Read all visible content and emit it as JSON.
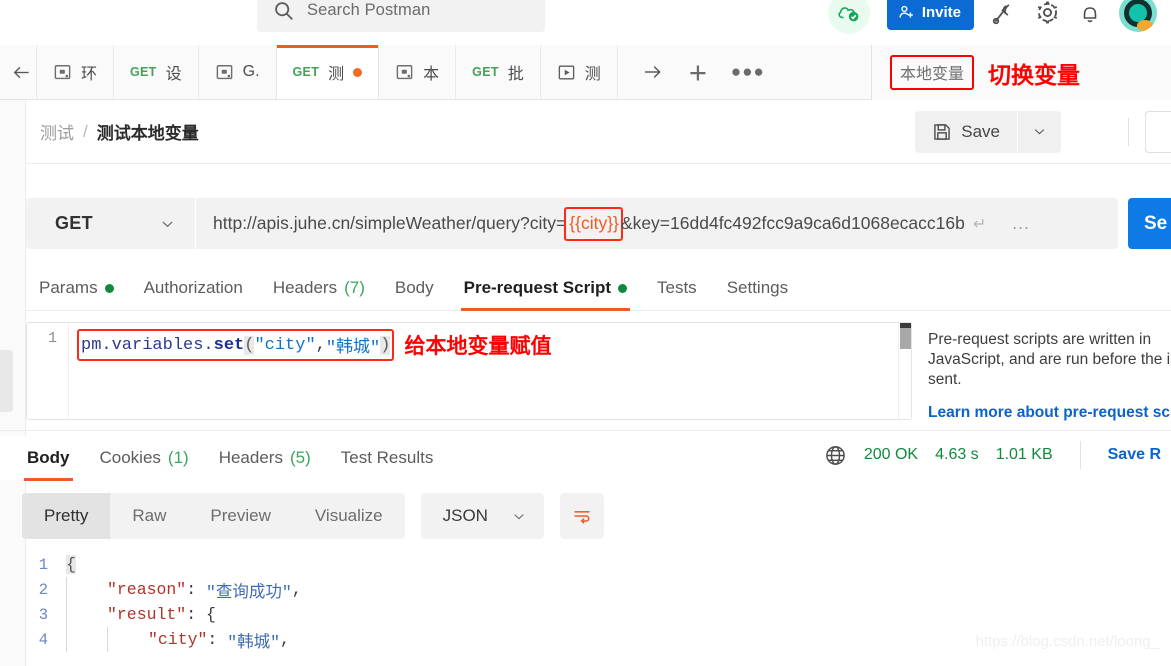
{
  "topbar": {
    "search_placeholder": "Search Postman",
    "invite_label": "Invite",
    "icons": [
      "cloud-sync-icon",
      "satellite-icon",
      "gear-icon",
      "bell-icon",
      "avatar"
    ]
  },
  "tabstrip": {
    "back_icon": "back-arrow-icon",
    "tabs": [
      {
        "icon": "collection-icon",
        "method": "",
        "name": "环"
      },
      {
        "icon": "",
        "method": "GET",
        "name": "设"
      },
      {
        "icon": "collection-icon",
        "method": "",
        "name": "G."
      },
      {
        "icon": "",
        "method": "GET",
        "name": "测",
        "unsaved": true,
        "active": true
      },
      {
        "icon": "collection-icon",
        "method": "",
        "name": "本"
      },
      {
        "icon": "",
        "method": "GET",
        "name": "批"
      },
      {
        "icon": "runner-icon",
        "method": "",
        "name": "测"
      }
    ],
    "forward_icon": "forward-arrow-icon",
    "new_tab_icon": "plus-icon",
    "more_icon": "ellipsis-icon",
    "environment": "本地变量",
    "annotation": "切换变量"
  },
  "breadcrumb": {
    "collection": "测试",
    "separator": "/",
    "request": "测试本地变量",
    "save_label": "Save",
    "save_icon": "floppy-disk-icon",
    "caret_icon": "chevron-down-icon",
    "more_icon": "ellipsis-icon"
  },
  "request": {
    "method": "GET",
    "url_prefix": "http://apis.juhe.cn/simpleWeather/query?city=",
    "url_variable": "{{city}}",
    "url_suffix": "&key=16dd4fc492fcc9a9ca6d1068ecacc16b",
    "url_full": "http://apis.juhe.cn/simpleWeather/query?city={{city}}&key=16dd4fc492fcc9a9ca6d1068ecacc16b",
    "enter_glyph": "↵",
    "overflow_dots": "...",
    "send_label": "Se",
    "tabs": [
      {
        "label": "Params",
        "dot": true
      },
      {
        "label": "Authorization"
      },
      {
        "label": "Headers",
        "count": "(7)"
      },
      {
        "label": "Body"
      },
      {
        "label": "Pre-request Script",
        "dot": true,
        "active": true
      },
      {
        "label": "Tests"
      },
      {
        "label": "Settings"
      }
    ]
  },
  "editor": {
    "line_number": "1",
    "code": {
      "obj": "pm.variables.",
      "fn": "set",
      "open": "(",
      "arg1": "\"city\"",
      "comma": ",",
      "arg2": "\"韩城\"",
      "close": ")"
    },
    "annotation": "给本地变量赋值"
  },
  "help": {
    "text": "Pre-request scripts are written in JavaScript, and are run before the is sent.",
    "link": "Learn more about pre-request scr"
  },
  "response": {
    "tabs": [
      {
        "label": "Body",
        "active": true
      },
      {
        "label": "Cookies",
        "count": "(1)"
      },
      {
        "label": "Headers",
        "count": "(5)"
      },
      {
        "label": "Test Results"
      }
    ],
    "globe_icon": "globe-icon",
    "status": "200 OK",
    "time": "4.63 s",
    "size": "1.01 KB",
    "save_response": "Save R",
    "view_modes": [
      "Pretty",
      "Raw",
      "Preview",
      "Visualize"
    ],
    "active_view": "Pretty",
    "format": "JSON",
    "format_caret": "chevron-down-icon",
    "wrap_icon": "word-wrap-icon",
    "body_lines": [
      {
        "n": "1",
        "indent": 0,
        "content": "{",
        "type": "brace"
      },
      {
        "n": "2",
        "indent": 1,
        "key": "\"reason\"",
        "value": "\"查询成功\"",
        "trail": ","
      },
      {
        "n": "3",
        "indent": 1,
        "key": "\"result\"",
        "value": "{",
        "trail": ""
      },
      {
        "n": "4",
        "indent": 2,
        "key": "\"city\"",
        "value": "\"韩城\"",
        "trail": ","
      }
    ]
  },
  "watermark": "https://blog.csdn.net/loong_"
}
